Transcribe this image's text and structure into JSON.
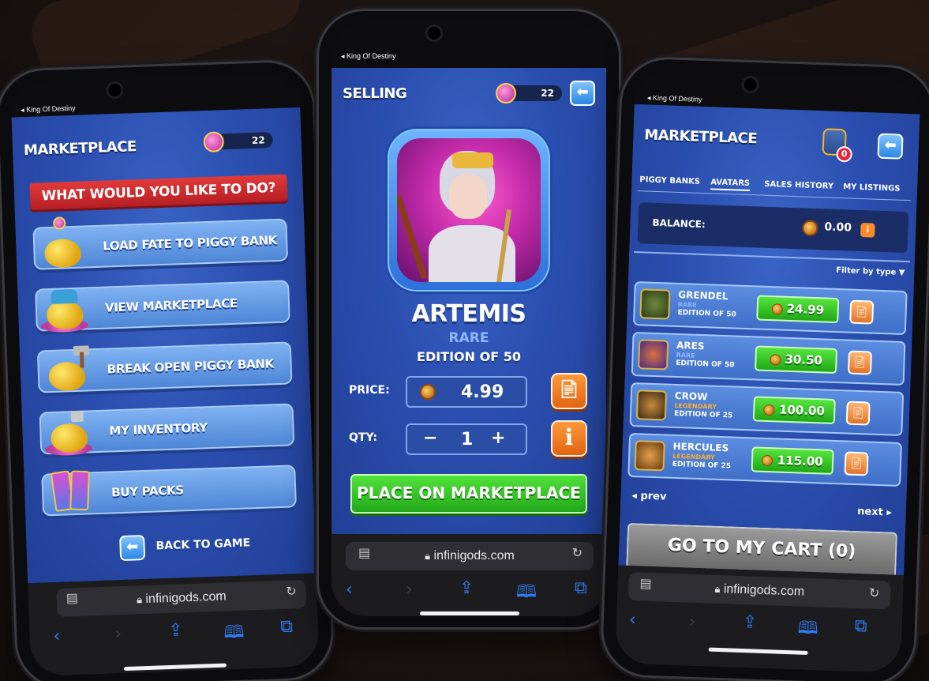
{
  "status_back": "◂ King Of Destiny",
  "fate_count": "22",
  "safari": {
    "url": "infinigods.com"
  },
  "left": {
    "title": "MARKETPLACE",
    "banner": "WHAT WOULD YOU LIKE TO DO?",
    "menu": [
      {
        "label": "LOAD FATE TO PIGGY BANK",
        "icon": "piggy-bank-fate-icon"
      },
      {
        "label": "VIEW MARKETPLACE",
        "icon": "marketplace-pig-icon"
      },
      {
        "label": "BREAK OPEN PIGGY BANK",
        "icon": "hammer-piggy-icon"
      },
      {
        "label": "MY INVENTORY",
        "icon": "inventory-pig-icon"
      },
      {
        "label": "BUY PACKS",
        "icon": "card-packs-icon"
      }
    ],
    "back_to_game": "BACK TO GAME"
  },
  "center": {
    "title": "SELLING",
    "item": {
      "name": "ARTEMIS",
      "rarity": "RARE",
      "edition": "EDITION OF 50"
    },
    "price_label": "PRICE:",
    "price_value": "4.99",
    "qty_label": "QTY:",
    "qty_minus": "−",
    "qty_value": "1",
    "qty_plus": "+",
    "place_button": "PLACE ON MARKETPLACE"
  },
  "right": {
    "title": "MARKETPLACE",
    "cart_badge": "0",
    "tabs": [
      "PIGGY BANKS",
      "AVATARS",
      "SALES HISTORY",
      "MY LISTINGS"
    ],
    "active_tab": "AVATARS",
    "balance_label": "BALANCE:",
    "balance_value": "0.00",
    "filter_label": "Filter by type ▼",
    "listings": [
      {
        "name": "GRENDEL",
        "rarity": "RARE",
        "edition": "EDITION OF 50",
        "price": "24.99",
        "rarity_color": "#8fb7ff"
      },
      {
        "name": "ARES",
        "rarity": "RARE",
        "edition": "EDITION OF 50",
        "price": "30.50",
        "rarity_color": "#8fb7ff"
      },
      {
        "name": "CROW",
        "rarity": "LEGENDARY",
        "edition": "EDITION OF 25",
        "price": "100.00",
        "rarity_color": "#ffb12a"
      },
      {
        "name": "HERCULES",
        "rarity": "LEGENDARY",
        "edition": "EDITION OF 25",
        "price": "115.00",
        "rarity_color": "#ffb12a"
      }
    ],
    "prev": "◂ prev",
    "next": "next ▸",
    "cart_button": "GO TO MY CART (0)"
  },
  "colors": {
    "app_blue": "#2b4fb0",
    "action_green": "#22a81a",
    "accent_orange": "#e26412",
    "safari_blue": "#2f7df6"
  }
}
